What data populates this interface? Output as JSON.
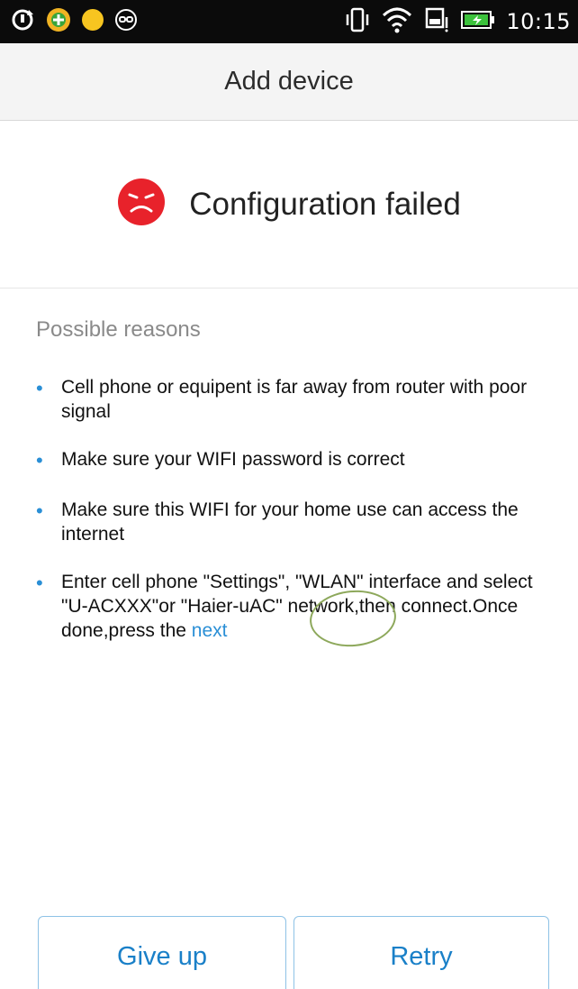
{
  "status_bar": {
    "time": "10:15",
    "left_icons": [
      "sync-icon",
      "app-green-icon",
      "app-yellow-icon",
      "goggles-icon"
    ],
    "right_icons": [
      "vibrate-icon",
      "wifi-icon",
      "sim-icon",
      "battery-icon"
    ]
  },
  "header": {
    "title": "Add device"
  },
  "result": {
    "text": "Configuration failed",
    "icon": "sad-face-icon",
    "icon_color": "#e8222b"
  },
  "reasons": {
    "heading": "Possible reasons",
    "items": [
      {
        "text": "Cell phone or equipent is far away from router with poor signal"
      },
      {
        "text": "Make sure your WIFI password is correct"
      },
      {
        "text": "Make sure this WIFI for your home use can access the internet"
      },
      {
        "text": "Enter cell phone \"Settings\", \"WLAN\" interface and select \"U-ACXXX\"or \"Haier-uAC\" network,then connect.Once done,press the ",
        "link": "next"
      }
    ]
  },
  "buttons": {
    "give_up": "Give up",
    "retry": "Retry"
  },
  "colors": {
    "accent": "#2a8fd6",
    "error": "#e8222b"
  }
}
